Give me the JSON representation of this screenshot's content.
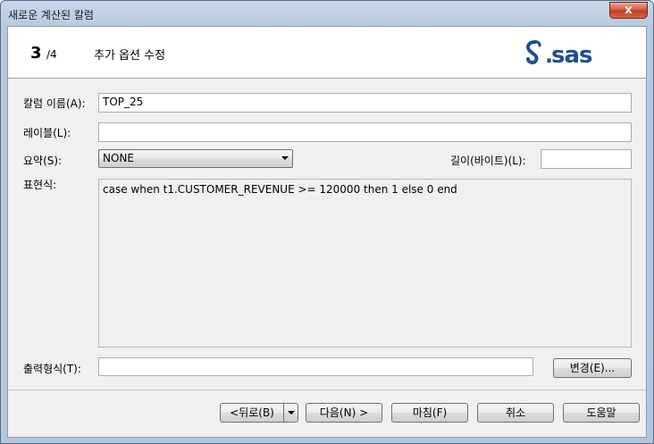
{
  "window": {
    "title": "새로운 계산된 칼럼",
    "close_label": "x"
  },
  "wizard": {
    "step_current": "3",
    "step_total": "/4",
    "step_title": "추가 옵션 수정",
    "logo_text": "sas"
  },
  "form": {
    "column_name_label": "칼럼 이름(A):",
    "column_name_value": "TOP_25",
    "label_label": "레이블(L):",
    "label_value": "",
    "summary_label": "요약(S):",
    "summary_value": "NONE",
    "length_label": "길이(바이트)(L):",
    "length_value": "",
    "expression_label": "표현식:",
    "expression_value": "case when t1.CUSTOMER_REVENUE >= 120000 then 1 else 0 end",
    "format_label": "출력형식(T):",
    "format_value": "",
    "change_button": "변경(E)..."
  },
  "footer": {
    "back_button": "<뒤로(B)",
    "next_button": "다음(N) >",
    "finish_button": "마침(F)",
    "cancel_button": "취소",
    "help_button": "도움말"
  },
  "colors": {
    "sas_blue": "#1f4f8f",
    "title_gradient_top": "#c9d8ea",
    "close_red": "#c2381e"
  }
}
